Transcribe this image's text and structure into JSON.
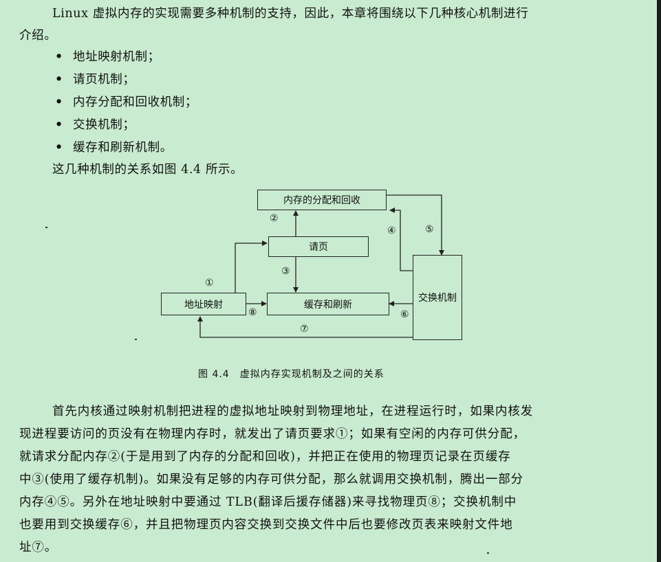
{
  "intro": {
    "line1": "Linux 虚拟内存的实现需要多种机制的支持，因此，本章将围绕以下几种核心机制进行",
    "line2": "介绍。"
  },
  "bullets": [
    {
      "bullet": "•",
      "text": "地址映射机制；"
    },
    {
      "bullet": "•",
      "text": "请页机制；"
    },
    {
      "bullet": "•",
      "text": "内存分配和回收机制；"
    },
    {
      "bullet": "•",
      "text": "交换机制；"
    },
    {
      "bullet": "•",
      "text": "缓存和刷新机制。"
    }
  ],
  "relation_text": "这几种机制的关系如图 4.4 所示。",
  "diagram": {
    "boxes": {
      "alloc": "内存的分配和回收",
      "page_request": "请页",
      "address_map": "地址映射",
      "cache_flush": "缓存和刷新",
      "swap": "交换机制"
    },
    "labels": {
      "n1": "①",
      "n2": "②",
      "n3": "③",
      "n4": "④",
      "n5": "⑤",
      "n6": "⑥",
      "n7": "⑦",
      "n8": "⑧"
    }
  },
  "caption": "图 4.4　虚拟内存实现机制及之间的关系",
  "body": [
    "首先内核通过映射机制把进程的虚拟地址映射到物理地址，在进程运行时，如果内核发",
    "现进程要访问的页没有在物理内存时，就发出了请页要求①；如果有空闲的内存可供分配，",
    "就请求分配内存②(于是用到了内存的分配和回收)，并把正在使用的物理页记录在页缓存",
    "中③(使用了缓存机制)。如果没有足够的内存可供分配，那么就调用交换机制，腾出一部分",
    "内存④⑤。另外在地址映射中要通过 TLB(翻译后援存储器)来寻找物理页⑧；交换机制中",
    "也要用到交换缓存⑥，并且把物理页内容交换到交换文件中后也要修改页表来映射文件地",
    "址⑦。"
  ]
}
